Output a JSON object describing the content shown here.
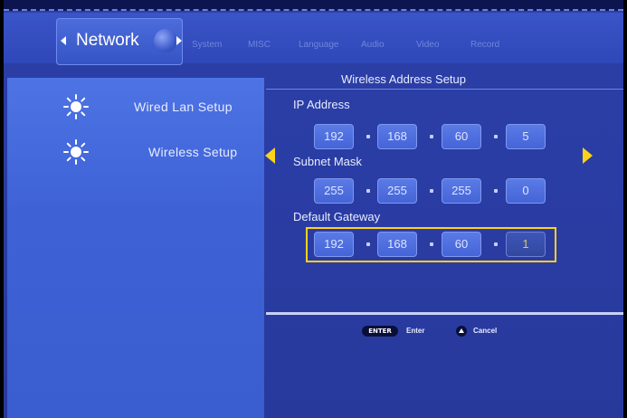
{
  "tabs": {
    "active": "Network",
    "others": [
      "System",
      "MISC",
      "Language",
      "Audio",
      "Video",
      "Record"
    ]
  },
  "sidebar": {
    "items": [
      {
        "label": "Wired Lan Setup",
        "icon": "sun-icon"
      },
      {
        "label": "Wireless Setup",
        "icon": "sun-icon"
      }
    ]
  },
  "panel": {
    "title": "Wireless Address Setup",
    "ip": {
      "label": "IP Address",
      "octets": [
        "192",
        "168",
        "60",
        "5"
      ]
    },
    "subnet": {
      "label": "Subnet Mask",
      "octets": [
        "255",
        "255",
        "255",
        "0"
      ]
    },
    "gateway": {
      "label": "Default Gateway",
      "octets": [
        "192",
        "168",
        "60",
        "1"
      ]
    }
  },
  "footer": {
    "enter_key": "ENTER",
    "enter_label": "Enter",
    "cancel_label": "Cancel"
  },
  "colors": {
    "background": "#2a3ca2",
    "sidebar": "#4468dc",
    "selection": "#ffd21a",
    "text": "#e8ecff"
  }
}
